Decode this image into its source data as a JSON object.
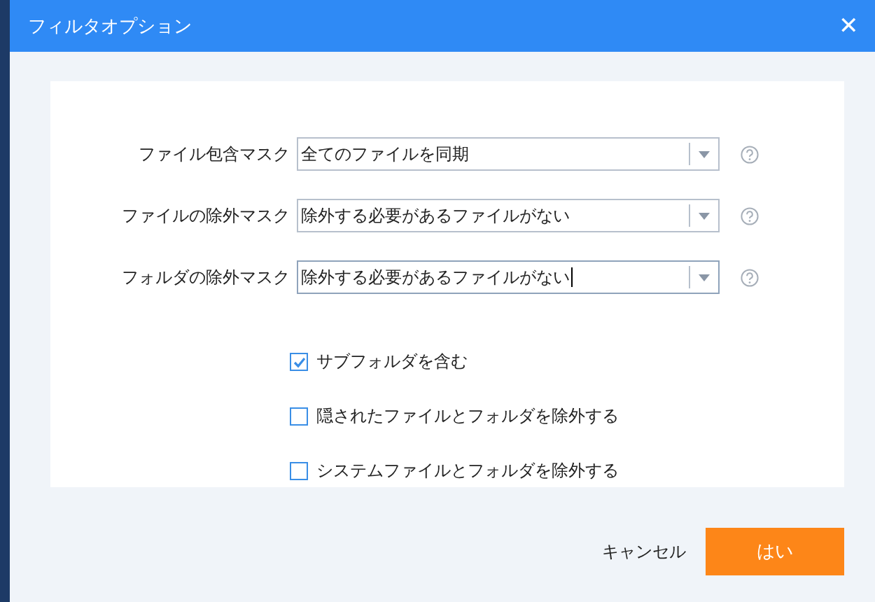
{
  "window": {
    "title": "フィルタオプション",
    "close": "✕"
  },
  "masks": [
    {
      "label": "ファイル包含マスク",
      "value": "全てのファイルを同期",
      "focused": false
    },
    {
      "label": "ファイルの除外マスク",
      "value": "除外する必要があるファイルがない",
      "focused": false
    },
    {
      "label": "フォルダの除外マスク",
      "value": "除外する必要があるファイルがない",
      "focused": true
    }
  ],
  "options": [
    {
      "label": "サブフォルダを含む",
      "checked": true
    },
    {
      "label": "隠されたファイルとフォルダを除外する",
      "checked": false
    },
    {
      "label": "システムファイルとフォルダを除外する",
      "checked": false
    }
  ],
  "buttons": {
    "cancel": "キャンセル",
    "ok": "はい"
  }
}
